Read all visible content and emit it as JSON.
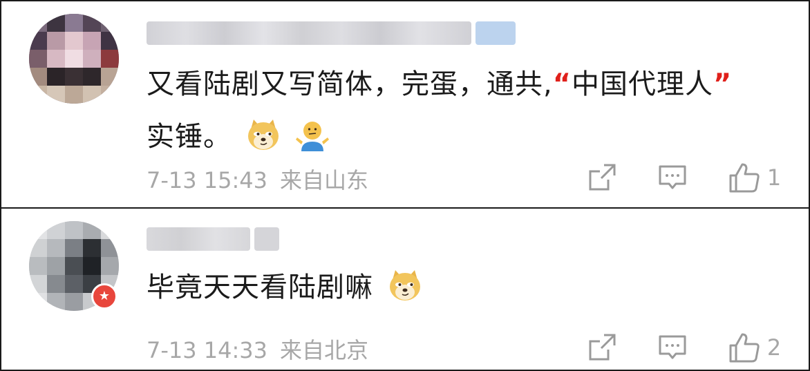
{
  "comments": [
    {
      "text_main": "又看陆剧又写简体，完蛋，通共,",
      "text_quote_open": "“",
      "text_quoted": "中国代理人",
      "text_quote_close": "”",
      "text_tail": "实锤。",
      "emojis": [
        "doge-emoji",
        "shrug-emoji"
      ],
      "date": "7-13 15:43",
      "location": "来自山东",
      "likes": "1"
    },
    {
      "text_main": "毕竟天天看陆剧嘛",
      "emojis": [
        "doge-emoji"
      ],
      "date": "7-13 14:33",
      "location": "来自北京",
      "likes": "2"
    }
  ],
  "colors": {
    "quote_red": "#e0201b",
    "meta_gray": "#a7a7a7",
    "badge_red": "#e8463c"
  },
  "icons": [
    "share-icon",
    "reply-icon",
    "thumbs-up-icon"
  ]
}
